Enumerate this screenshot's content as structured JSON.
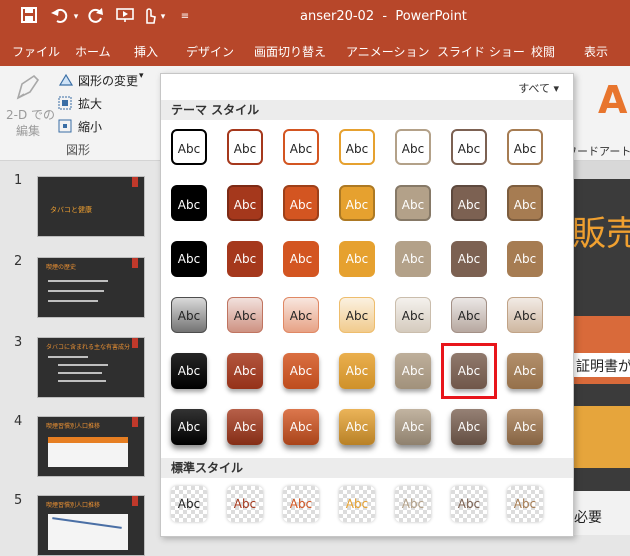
{
  "titlebar": {
    "title": "anser20-02  -  PowerPoint",
    "quick_access": [
      "save-icon",
      "undo-icon",
      "undo-dropdown",
      "redo-icon",
      "present-icon",
      "touch-icon",
      "touch-dropdown",
      "customize-icon"
    ]
  },
  "tabs": [
    "ファイル",
    "ホーム",
    "挿入",
    "デザイン",
    "画面切り替え",
    "アニメーション",
    "スライド ショー",
    "校閲",
    "表示"
  ],
  "ribbon": {
    "twod_label_1": "2-D での",
    "twod_label_2": "編集",
    "change_shape": "図形の変更",
    "enlarge": "拡大",
    "shrink": "縮小",
    "group_label": "図形",
    "wordart_label": "ワードアートの"
  },
  "thumbnails": [
    {
      "num": "1",
      "title": "タバコと健康"
    },
    {
      "num": "2",
      "title": "喫煙の歴史"
    },
    {
      "num": "3",
      "title": "タバコに含まれる主な有害成分"
    },
    {
      "num": "4",
      "title": "喫煙習慣別人口推移"
    },
    {
      "num": "5",
      "title": "喫煙習慣別人口推移"
    }
  ],
  "slide_area": {
    "big_text": "販売",
    "line1": "証明書が",
    "line2": "必要"
  },
  "gallery": {
    "filter_label": "すべて ▾",
    "theme_header": "テーマ スタイル",
    "standard_header": "標準スタイル",
    "cell_text": "Abc",
    "colors": [
      "#000000",
      "#a5381c",
      "#d35521",
      "#e6a12f",
      "#b3a189",
      "#7c6152",
      "#a67c52"
    ],
    "selected_row": 5,
    "selected_col": 5
  }
}
